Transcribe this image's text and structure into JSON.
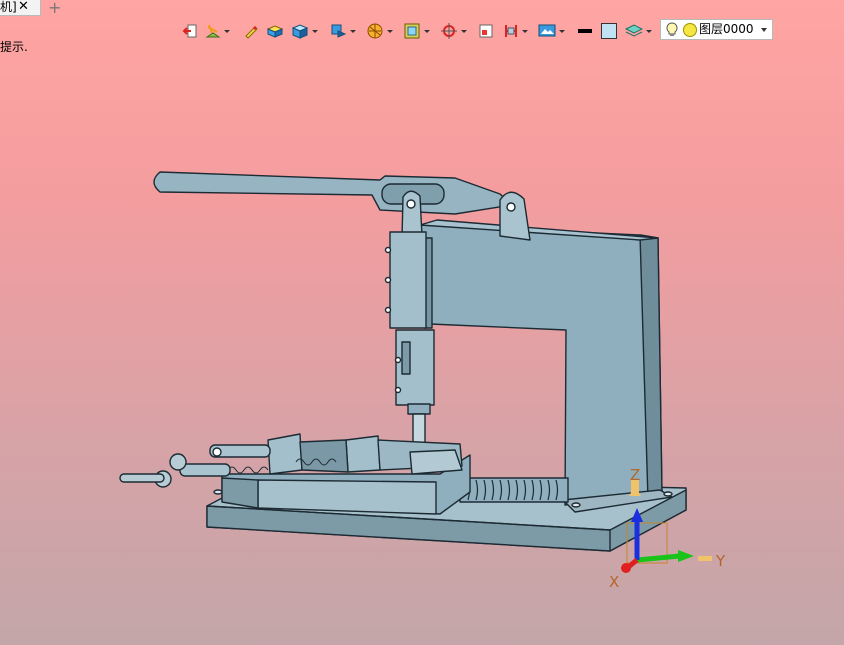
{
  "tab": {
    "label": "机]",
    "close": "✕",
    "new": "+"
  },
  "hint": "提示.",
  "toolbar": {
    "items": [
      "exit-sketch-icon",
      "sketch-tools-icon",
      "pencil-icon",
      "solid-icon",
      "view-cube-icon",
      "view-direction-icon",
      "render-style-icon",
      "frame-icon",
      "origin-icon",
      "section-icon",
      "dimension-icon",
      "display-icon",
      "line-color-icon",
      "fill-color-icon",
      "layer-stack-icon"
    ]
  },
  "layer": {
    "value": "图层0000"
  },
  "axes": {
    "x": "X",
    "y": "Y",
    "z": "Z"
  },
  "colors": {
    "background_top": "#ffa5a3",
    "background_bottom": "#c3a6a9",
    "model_fill": "#8fafbe",
    "model_stroke": "#1c2a33",
    "axis_x": "#e02020",
    "axis_y": "#19c319",
    "axis_z": "#1a2fe0"
  }
}
